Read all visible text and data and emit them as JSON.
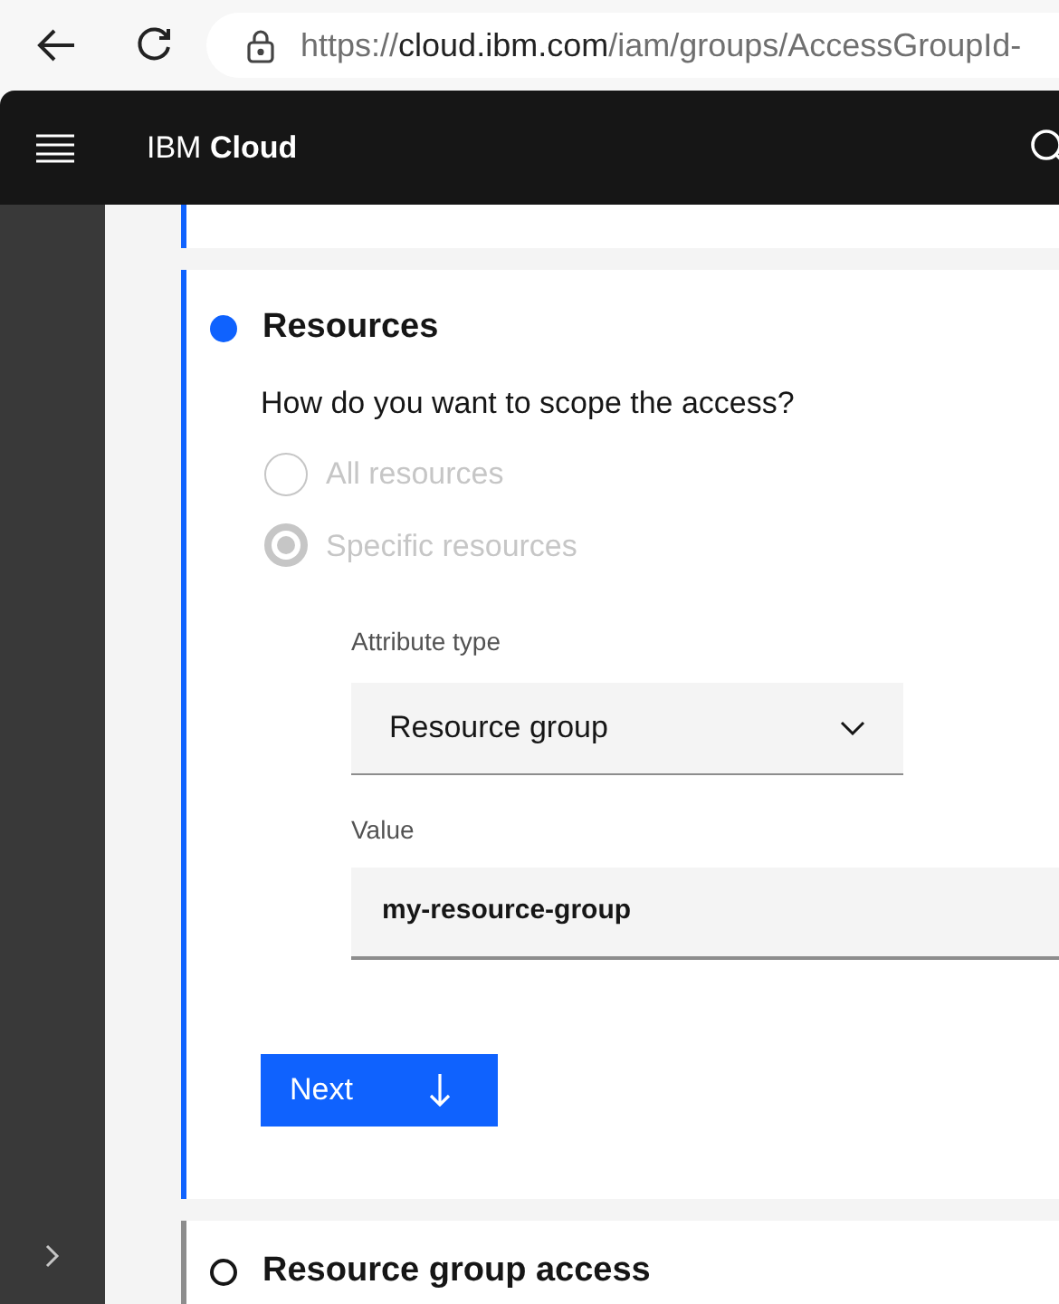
{
  "browser": {
    "url": {
      "scheme": "https://",
      "host": "cloud.ibm.com",
      "path": "/iam/groups/AccessGroupId-"
    }
  },
  "header": {
    "brand_prefix": "IBM",
    "brand_name": "Cloud"
  },
  "steps": [
    {
      "title": "Resources",
      "current": true,
      "question": "How do you want to scope the access?",
      "options": [
        {
          "label": "All resources",
          "selected": false,
          "disabled": true
        },
        {
          "label": "Specific resources",
          "selected": true,
          "disabled": true
        }
      ],
      "fields": [
        {
          "kind": "dropdown",
          "label": "Attribute type",
          "value": "Resource group"
        },
        {
          "kind": "text",
          "label": "Value",
          "value": "my-resource-group"
        }
      ],
      "button": "Next"
    },
    {
      "title": "Resource group access",
      "current": false
    }
  ]
}
